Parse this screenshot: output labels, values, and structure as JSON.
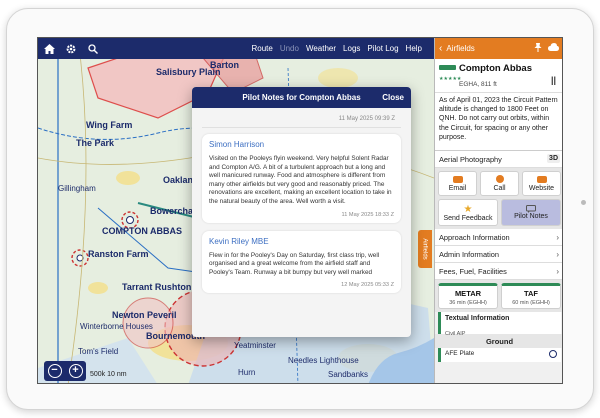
{
  "toolbar": {
    "menu": [
      "Route",
      "Undo",
      "Weather",
      "Logs",
      "Pilot Log",
      "Help"
    ]
  },
  "map": {
    "labels": {
      "barton": "Barton",
      "wing_farm": "Wing Farm",
      "park": "The Park",
      "gillingham": "Gillingham",
      "oaklands": "Oaklands",
      "bowerchalke": "Bowerchalke",
      "compton": "COMPTON ABBAS",
      "ranston": "Ranston Farm",
      "tarrant": "Tarrant Rushton",
      "newton": "Newton Peveril",
      "bournemouth": "Bournemouth",
      "winterborne": "Winterborne Houses",
      "yeatminster": "Yeatminster",
      "fields": "Tom's Field",
      "hurn": "Hurn",
      "needles": "Needles Lighthouse",
      "sandbanks": "Sandbanks",
      "salisbury": "Salisbury Plain",
      "scale": "500k 10 nm"
    },
    "side_tab": "Airfields"
  },
  "popup": {
    "title": "Pilot Notes for Compton Abbas",
    "close": "Close",
    "top_timestamp": "11 May 2025 09:39 Z",
    "notes": [
      {
        "author": "Simon Harrison",
        "text": "Visited on the Pooleys flyin weekend. Very helpful Solent Radar and Compton A/G. A bit of a turbulent approach but a long and well manicured runway. Food and atmosphere is different from many other airfields but very good and reasonably priced. The renovations are excellent, making an excellent location to take in the natural beauty of the area. Well worth a visit.",
        "timestamp": "11 May 2025 18:33 Z"
      },
      {
        "author": "Kevin Riley MBE",
        "text": "Flew in for the Pooley's Day on Saturday, first class trip, well organised and a great welcome from the airfield staff and Pooley's Team. Runway a bit bumpy but very well marked",
        "timestamp": "12 May 2025 05:33 Z"
      }
    ]
  },
  "panel": {
    "header": "Airfields",
    "airfield_name": "Compton Abbas",
    "airfield_code": "EGHA, 811 ft",
    "wind_indicator": "||",
    "notam": "As of April 01, 2023 the Circuit Pattern altitude is changed to 1800 Feet on QNH. Do not carry out orbits, within the Circuit, for spacing or any other purpose.",
    "aerial": "Aerial Photography",
    "aerial_tag": "3D",
    "buttons": [
      "Email",
      "Call",
      "Website"
    ],
    "buttons2": [
      "Send Feedback",
      "Pilot Notes"
    ],
    "rows": [
      "Approach Information",
      "Admin Information",
      "Fees, Fuel, Facilities"
    ],
    "metar": {
      "label": "METAR",
      "sub": "36 min (EGHH)"
    },
    "taf": {
      "label": "TAF",
      "sub": "60 min (EGHH)"
    },
    "textual": {
      "label": "Textual Information",
      "sub": "Civil AIP"
    },
    "ground_label": "Ground",
    "afe": "AFE Plate"
  },
  "colors": {
    "navy": "#1c2b6b",
    "orange": "#e37c21",
    "green": "#2e8b57"
  }
}
